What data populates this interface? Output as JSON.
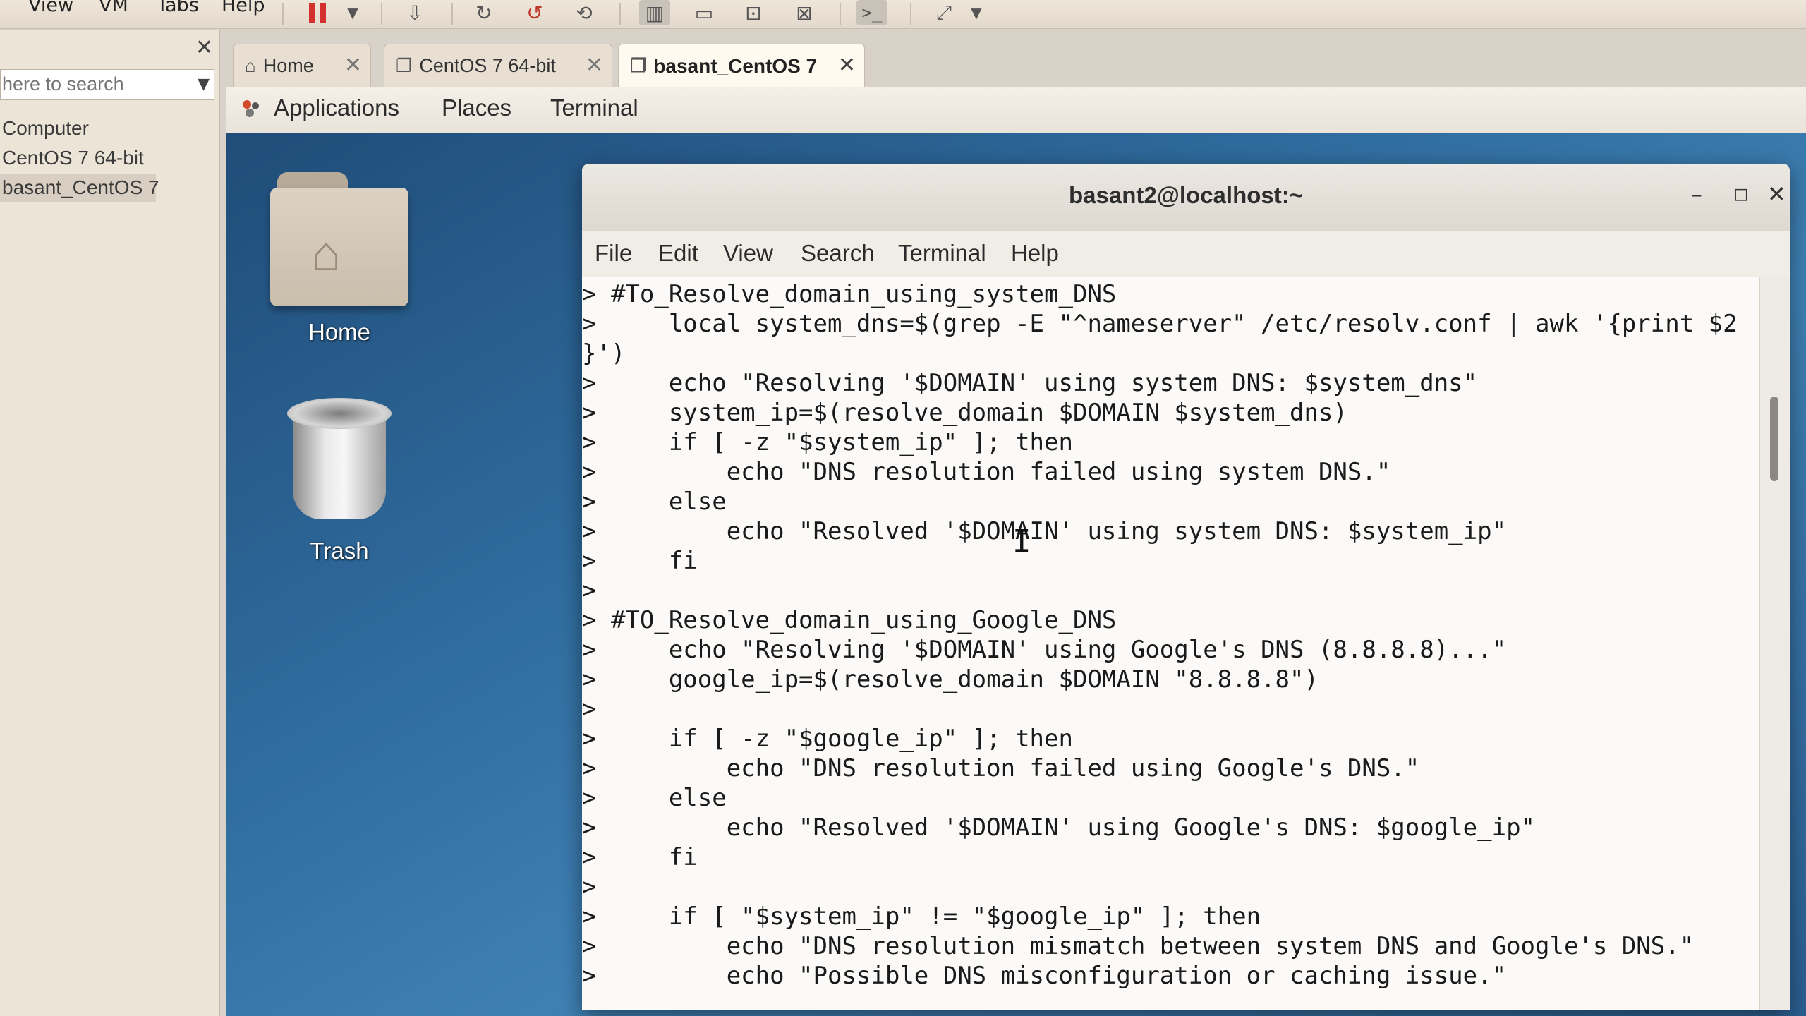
{
  "host": {
    "menus": [
      "View",
      "VM",
      "Tabs",
      "Help"
    ]
  },
  "library": {
    "search_placeholder": "here to search",
    "items": [
      "Computer",
      "CentOS 7 64-bit",
      "basant_CentOS 7"
    ]
  },
  "vm_tabs": [
    {
      "label": "Home",
      "icon": "home-icon"
    },
    {
      "label": "CentOS 7 64-bit",
      "icon": "vm-icon"
    },
    {
      "label": "basant_CentOS 7",
      "icon": "vm-running-icon"
    }
  ],
  "gnome_bar": {
    "applications": "Applications",
    "places": "Places",
    "terminal": "Terminal"
  },
  "desktop": {
    "home_label": "Home",
    "trash_label": "Trash"
  },
  "terminal": {
    "title": "basant2@localhost:~",
    "menu": [
      "File",
      "Edit",
      "View",
      "Search",
      "Terminal",
      "Help"
    ],
    "lines": [
      "> #To_Resolve_domain_using_system_DNS",
      ">     local system_dns=$(grep -E \"^nameserver\" /etc/resolv.conf | awk '{print $2",
      "}')",
      ">     echo \"Resolving '$DOMAIN' using system DNS: $system_dns\"",
      ">     system_ip=$(resolve_domain $DOMAIN $system_dns)",
      ">     if [ -z \"$system_ip\" ]; then",
      ">         echo \"DNS resolution failed using system DNS.\"",
      ">     else",
      ">         echo \"Resolved '$DOMAIN' using system DNS: $system_ip\"",
      ">     fi",
      ">",
      "> #TO_Resolve_domain_using_Google_DNS",
      ">     echo \"Resolving '$DOMAIN' using Google's DNS (8.8.8.8)...\"",
      ">     google_ip=$(resolve_domain $DOMAIN \"8.8.8.8\")",
      ">",
      ">     if [ -z \"$google_ip\" ]; then",
      ">         echo \"DNS resolution failed using Google's DNS.\"",
      ">     else",
      ">         echo \"Resolved '$DOMAIN' using Google's DNS: $google_ip\"",
      ">     fi",
      ">",
      ">     if [ \"$system_ip\" != \"$google_ip\" ]; then",
      ">         echo \"DNS resolution mismatch between system DNS and Google's DNS.\"",
      ">         echo \"Possible DNS misconfiguration or caching issue.\""
    ]
  }
}
